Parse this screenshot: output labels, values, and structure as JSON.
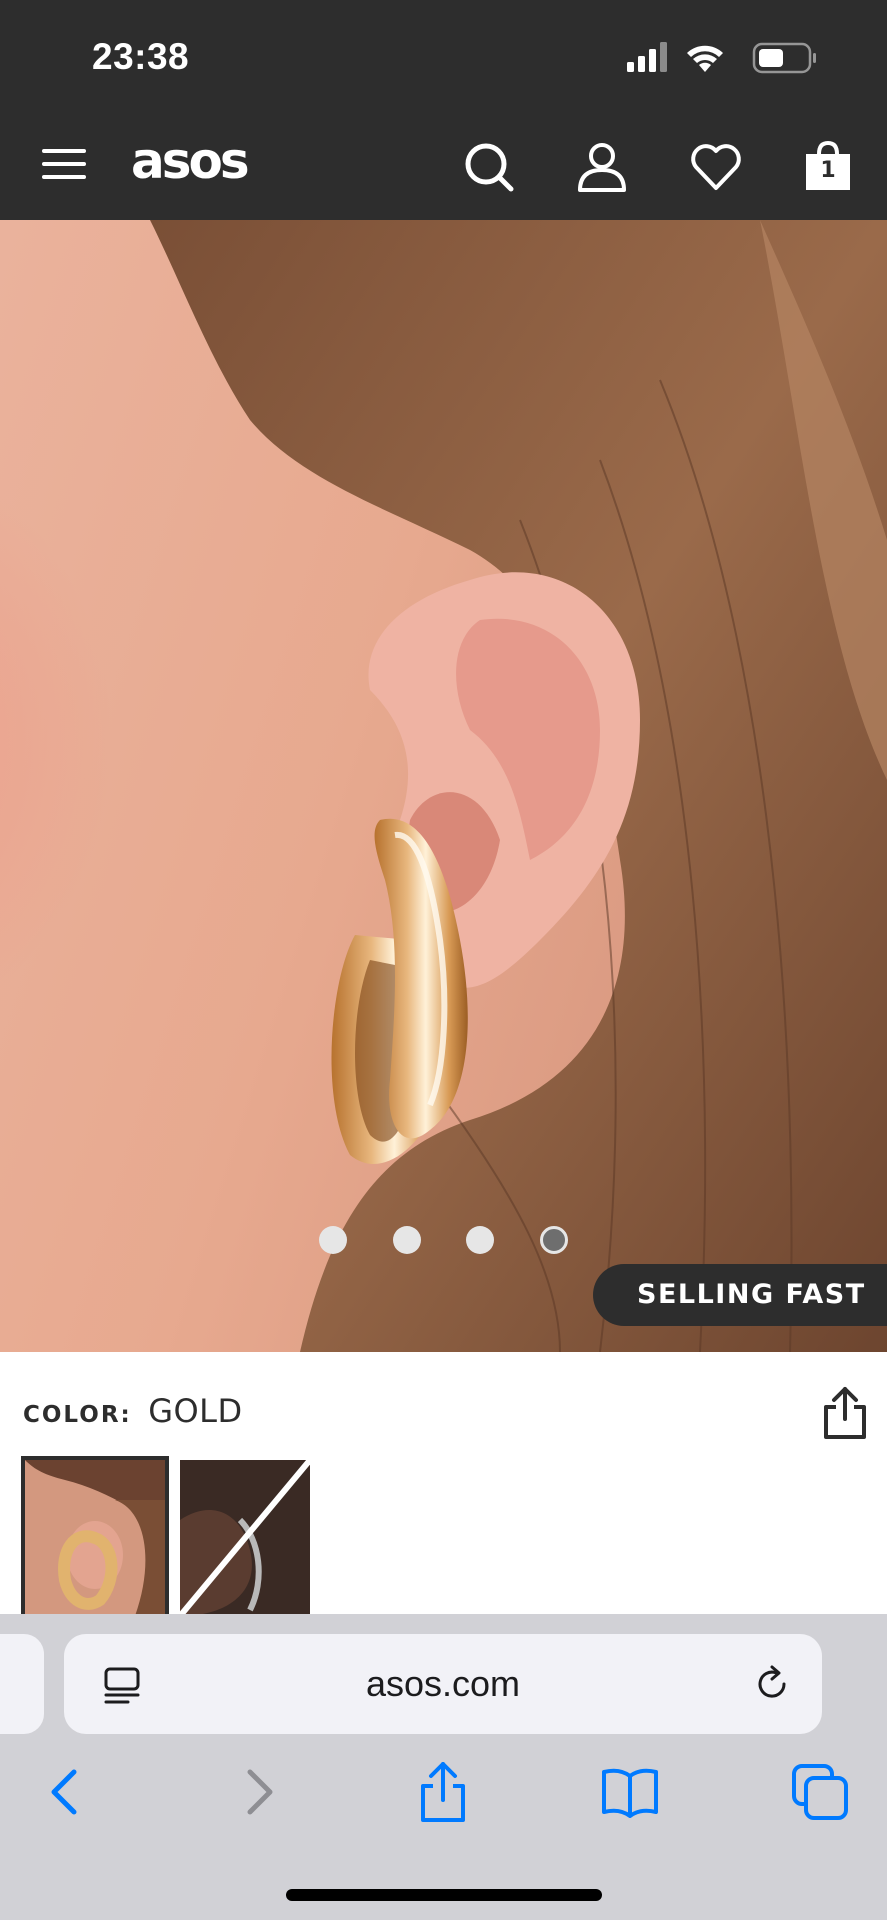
{
  "status_bar": {
    "time": "23:38",
    "icons": [
      "signal-icon",
      "wifi-icon",
      "battery-icon"
    ]
  },
  "header": {
    "logo": "asos",
    "icons": [
      "menu-icon",
      "search-icon",
      "account-icon",
      "wishlist-heart-icon",
      "bag-icon"
    ],
    "bag_count": "1"
  },
  "gallery": {
    "image": "model ear wearing chunky gold hoop earrings",
    "dot_count": 4,
    "active_dot": 4,
    "badge": "SELLING FAST"
  },
  "product": {
    "color_label": "COLOR:",
    "color_value": "GOLD",
    "swatches": [
      {
        "name": "gold",
        "selected": true,
        "available": true
      },
      {
        "name": "silver",
        "selected": false,
        "available": false
      }
    ]
  },
  "browser": {
    "url": "asos.com",
    "toolbar": [
      "back-icon",
      "forward-icon",
      "share-icon",
      "bookmarks-icon",
      "tabs-icon"
    ]
  },
  "colors": {
    "header_bg": "#2d2d2d",
    "ios_blue": "#007aff",
    "browser_bg": "#d1d1d6"
  }
}
